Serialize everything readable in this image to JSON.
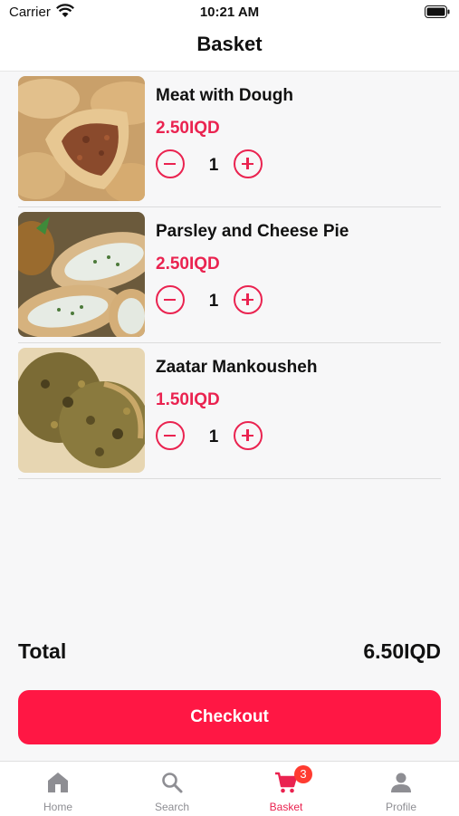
{
  "status": {
    "carrier": "Carrier",
    "time": "10:21 AM"
  },
  "header": {
    "title": "Basket"
  },
  "items": [
    {
      "name": "Meat with Dough",
      "price": "2.50IQD",
      "qty": "1"
    },
    {
      "name": "Parsley and Cheese Pie",
      "price": "2.50IQD",
      "qty": "1"
    },
    {
      "name": "Zaatar Mankousheh",
      "price": "1.50IQD",
      "qty": "1"
    }
  ],
  "summary": {
    "total_label": "Total",
    "total_value": "6.50IQD"
  },
  "checkout": {
    "label": "Checkout"
  },
  "tabs": [
    {
      "label": "Home",
      "icon": "home-icon"
    },
    {
      "label": "Search",
      "icon": "search-icon"
    },
    {
      "label": "Basket",
      "icon": "cart-icon",
      "badge": "3",
      "active": true
    },
    {
      "label": "Profile",
      "icon": "person-icon"
    }
  ],
  "colors": {
    "accent": "#ea2350",
    "button": "#ff1744",
    "badge": "#ff3b30",
    "inactive": "#8e8e93"
  }
}
